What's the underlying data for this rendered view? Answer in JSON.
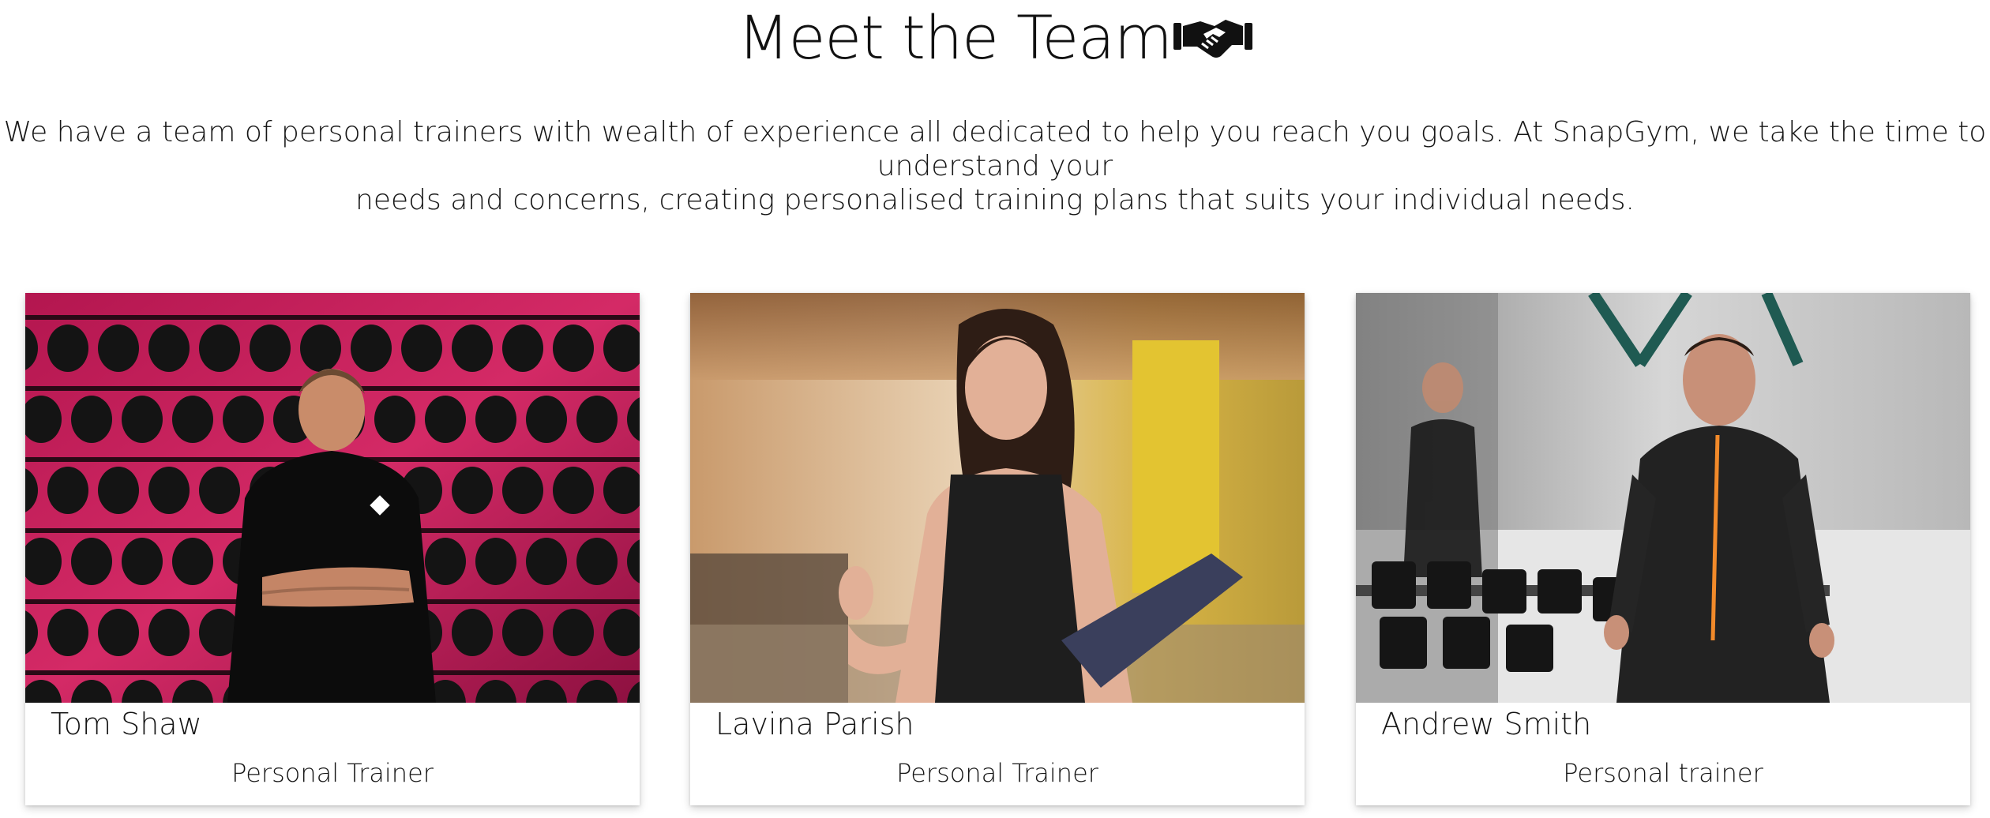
{
  "section": {
    "title": "Meet the Team",
    "title_icon": "handshake-icon",
    "intro": "We have a team of personal trainers with wealth of experience all dedicated to help you reach you goals. At SnapGym, we take the time to understand your\nneeds and concerns, creating personalised training plans that suits your individual needs."
  },
  "team": [
    {
      "name": "Tom Shaw",
      "role": "Personal Trainer",
      "photo": "trainer-photo-boxing-gloves-wall"
    },
    {
      "name": "Lavina Parish",
      "role": "Personal Trainer",
      "photo": "trainer-photo-gym-clipboard"
    },
    {
      "name": "Andrew Smith",
      "role": "Personal trainer",
      "photo": "trainer-photo-dumbbell-rack"
    }
  ],
  "colors": {
    "background": "#ffffff",
    "text": "#151515",
    "card_shadow": "rgba(0,0,0,0.18)"
  }
}
